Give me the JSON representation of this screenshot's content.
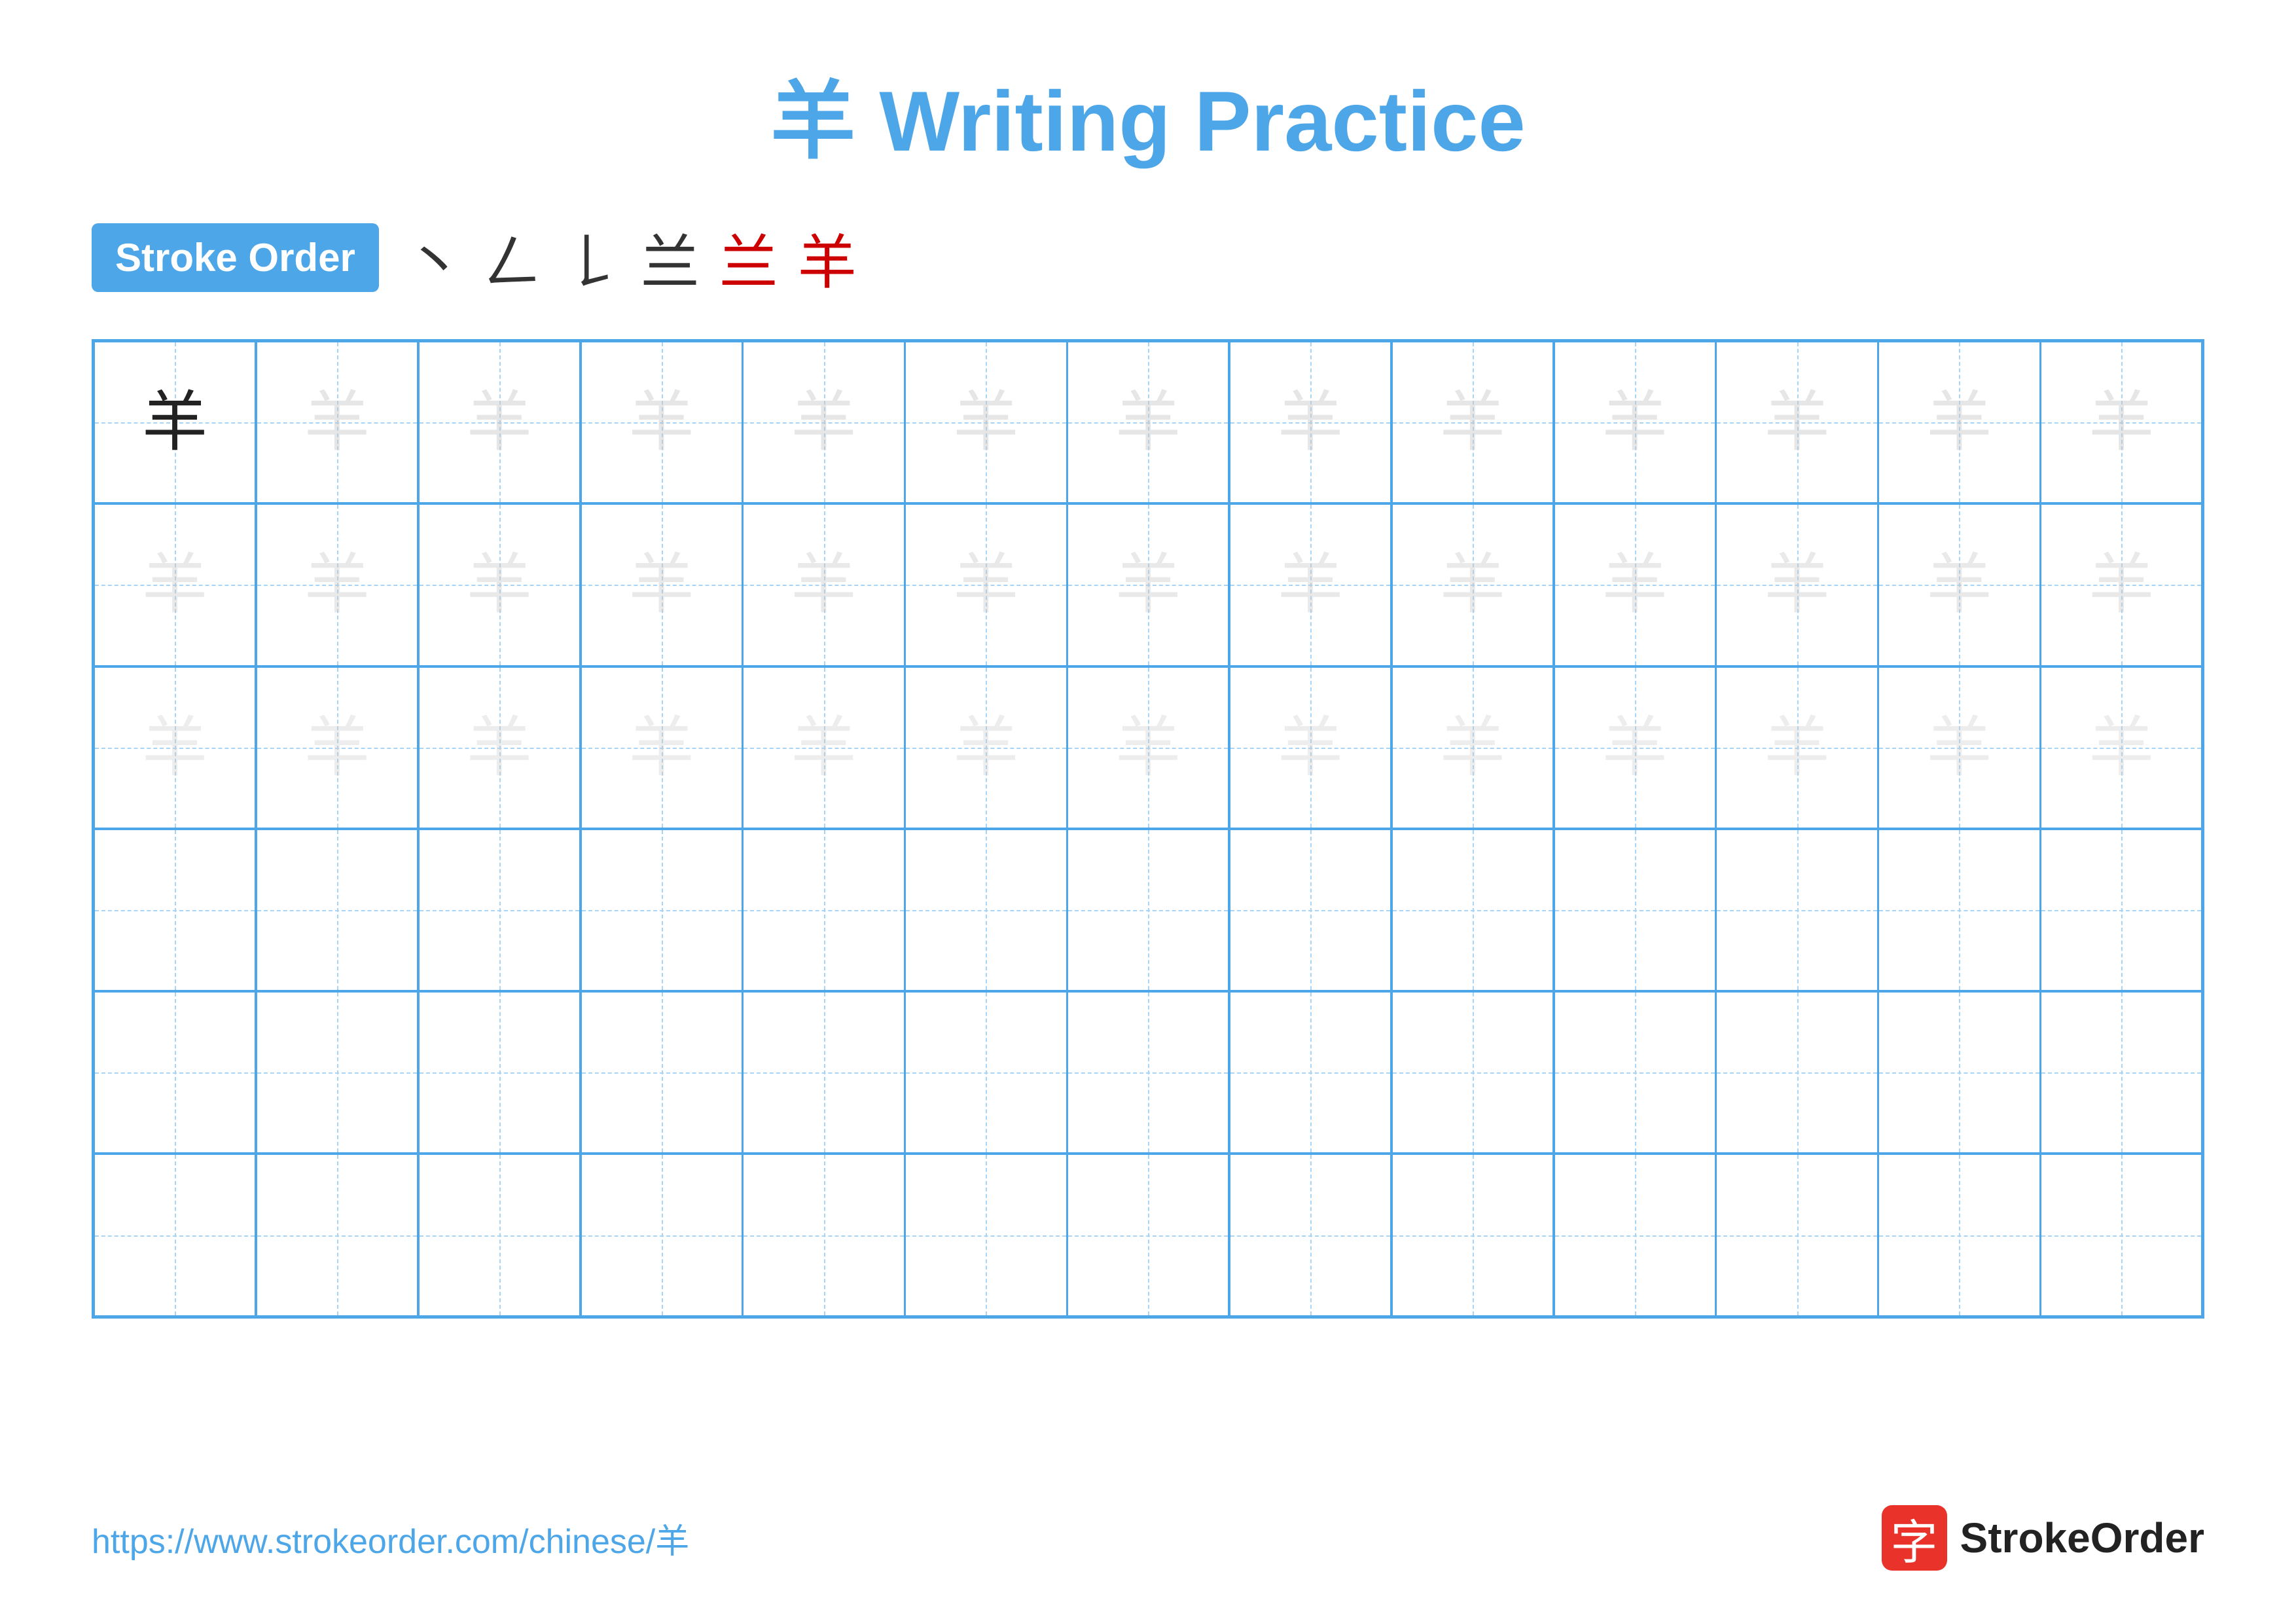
{
  "title": {
    "char": "羊",
    "text": " Writing Practice"
  },
  "stroke_order": {
    "badge_label": "Stroke Order",
    "steps": [
      "丶",
      "𠃋",
      "𠄌",
      "兰",
      "兰",
      "羊"
    ]
  },
  "grid": {
    "rows": 6,
    "cols": 13,
    "char": "羊",
    "filled_rows": 3,
    "first_cell_dark": true
  },
  "footer": {
    "url": "https://www.strokeorder.com/chinese/羊",
    "logo_char": "字",
    "logo_text": "StrokeOrder"
  }
}
